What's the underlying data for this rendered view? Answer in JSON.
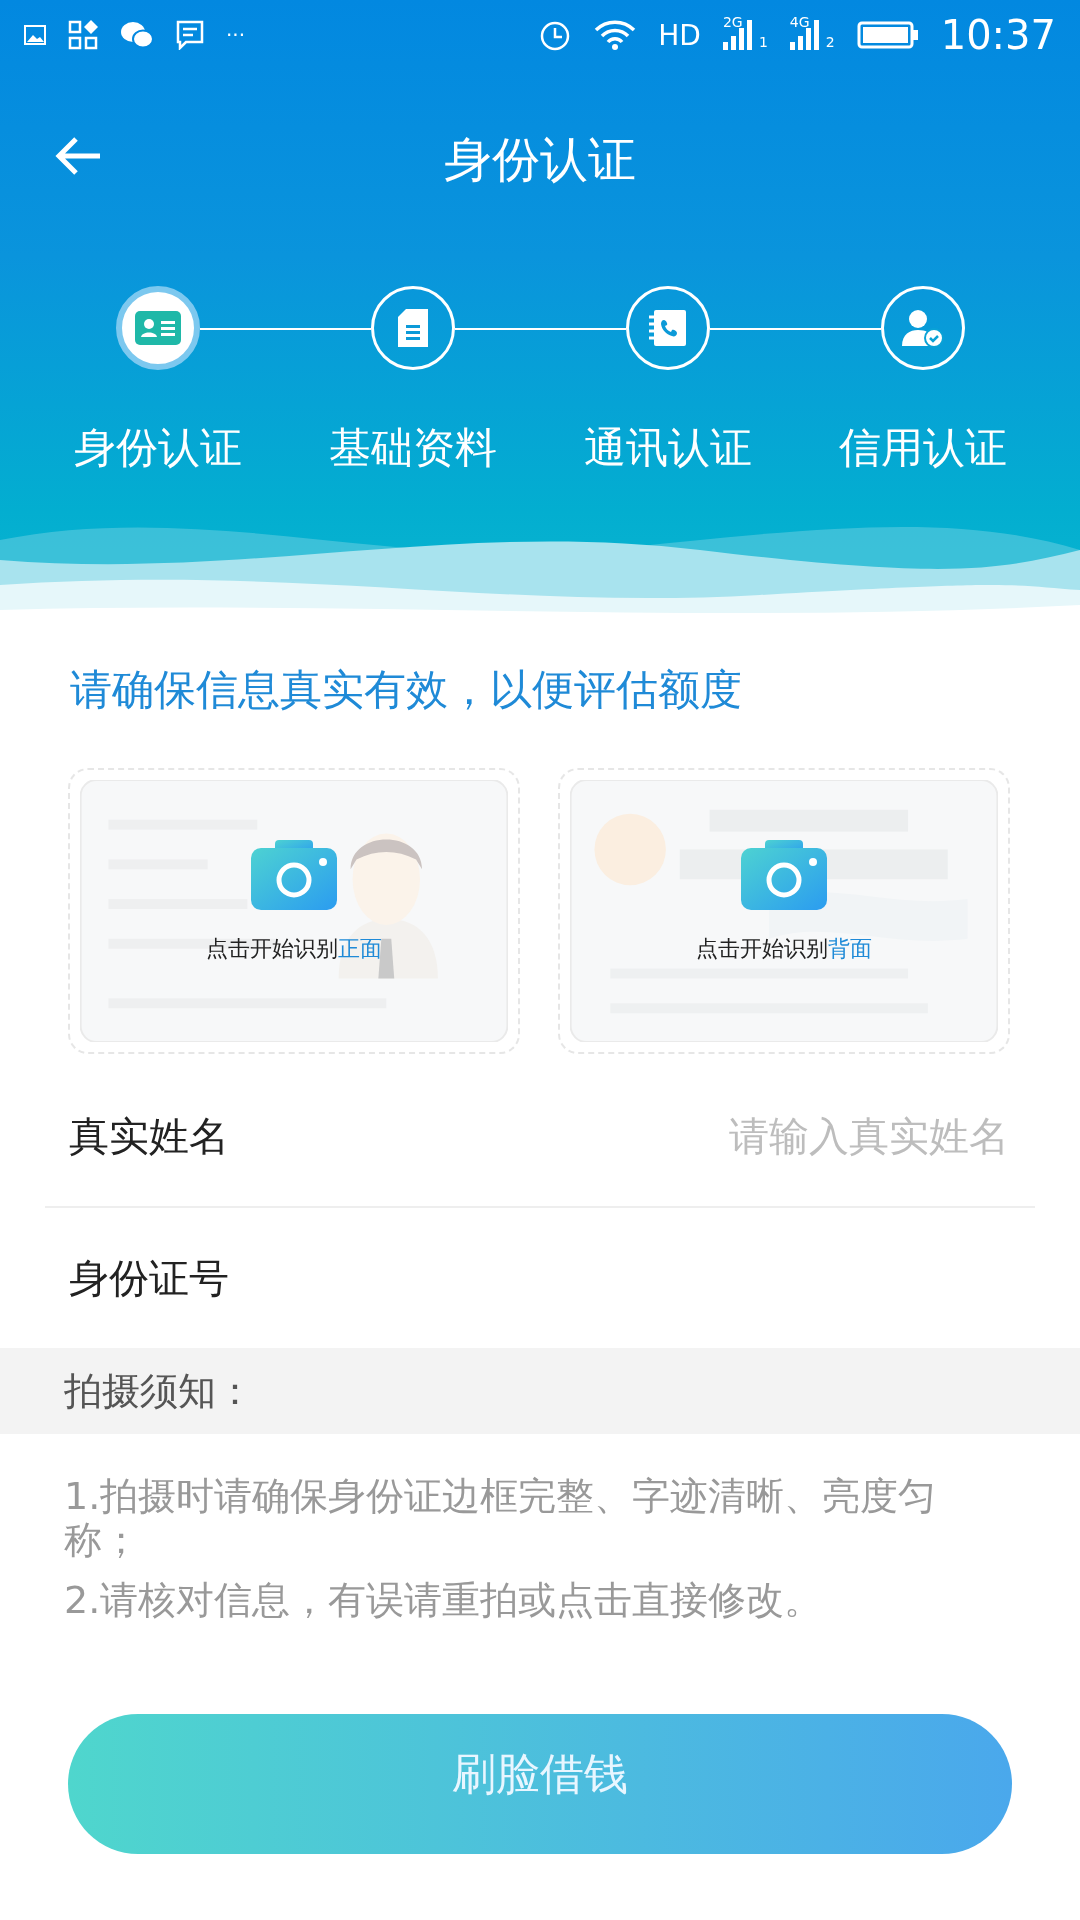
{
  "status_bar": {
    "more": "···",
    "network": "HD",
    "sim1_type": "2G",
    "sim1": "1",
    "sim2_type": "4G",
    "sim2": "2",
    "time": "10:37"
  },
  "header": {
    "title": "身份认证"
  },
  "steps": [
    {
      "label": "身份认证",
      "kind": "id",
      "selected": true
    },
    {
      "label": "基础资料",
      "kind": "doc",
      "selected": false
    },
    {
      "label": "通讯认证",
      "kind": "phone",
      "selected": false
    },
    {
      "label": "信用认证",
      "kind": "user",
      "selected": false
    }
  ],
  "notice": "请确保信息真实有效，以便评估额度",
  "cards": [
    {
      "caption": "点击开始识别**正面**",
      "kind": "front"
    },
    {
      "caption": "点击开始识别**背面**",
      "kind": "back"
    }
  ],
  "fields": [
    {
      "label": "真实姓名",
      "placeholder": "请输入真实姓名"
    },
    {
      "label": "身份证号"
    }
  ],
  "tips": {
    "title": "拍摄须知：",
    "items": [
      "1.拍摄时请确保身份证边框完整、字迹清晰、亮度匀称；",
      "2.请核对信息，有误请重拍或点击直接修改。"
    ]
  },
  "button": "刷脸借钱"
}
